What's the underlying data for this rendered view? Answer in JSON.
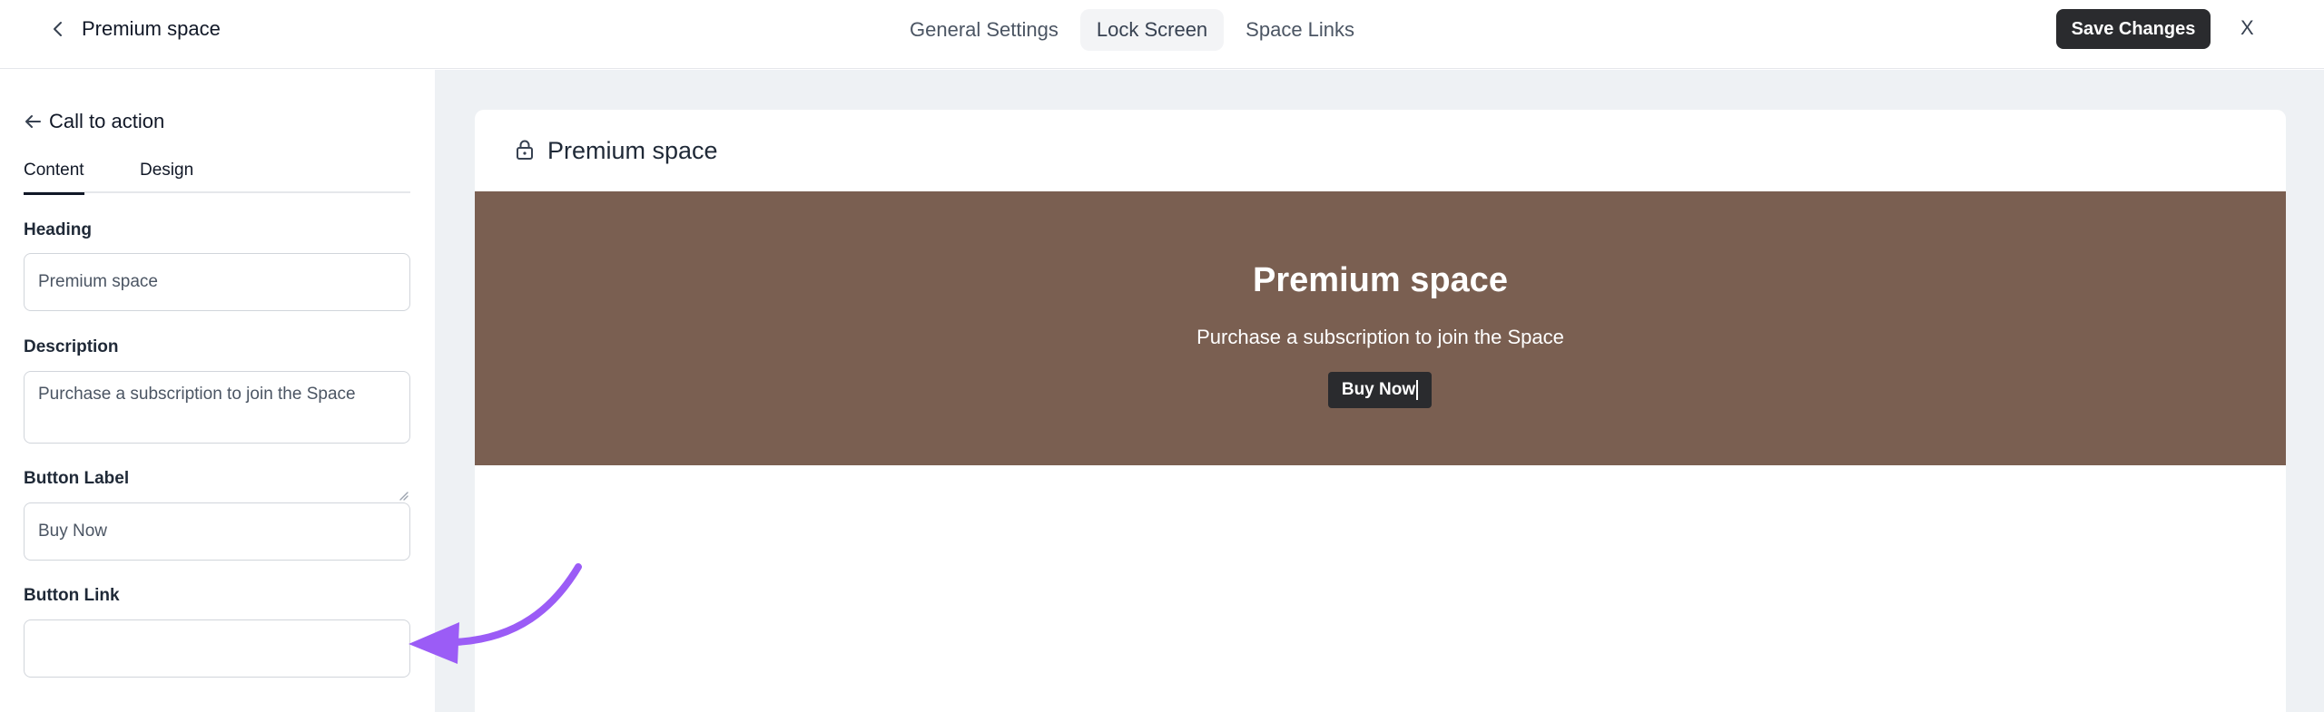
{
  "header": {
    "space_title": "Premium space",
    "tabs": [
      {
        "label": "General Settings",
        "active": false
      },
      {
        "label": "Lock Screen",
        "active": true
      },
      {
        "label": "Space Links",
        "active": false
      }
    ],
    "save_label": "Save Changes",
    "close_label": "X"
  },
  "panel": {
    "back_label": "Call to action",
    "subtabs": [
      {
        "label": "Content",
        "active": true
      },
      {
        "label": "Design",
        "active": false
      }
    ],
    "fields": {
      "heading": {
        "label": "Heading",
        "value": "Premium space"
      },
      "description": {
        "label": "Description",
        "value": "Purchase a subscription to join the Space"
      },
      "button_label": {
        "label": "Button Label",
        "value": "Buy Now"
      },
      "button_link": {
        "label": "Button Link",
        "value": ""
      }
    }
  },
  "preview": {
    "card_title": "Premium space",
    "banner": {
      "heading": "Premium space",
      "description": "Purchase a subscription to join the Space",
      "button": "Buy Now"
    }
  },
  "colors": {
    "banner_bg": "#7a5f51",
    "dark_button": "#2a2b2e",
    "annotation_arrow": "#9b5cf6",
    "preview_bg": "#eef1f4"
  },
  "icons": [
    "chevron-left-icon",
    "arrow-left-icon",
    "lock-icon",
    "annotation-arrow-icon"
  ]
}
